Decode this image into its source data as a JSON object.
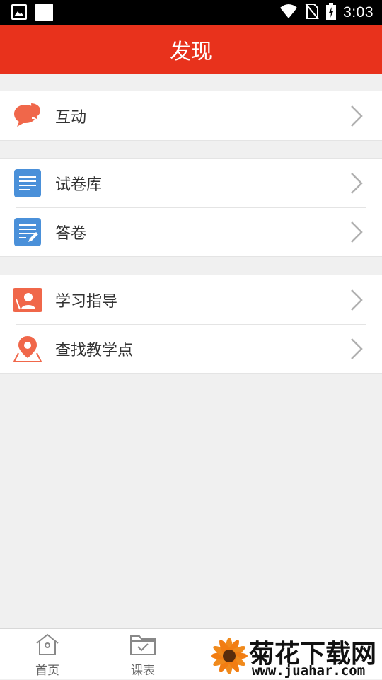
{
  "status_bar": {
    "time": "3:03",
    "icons": [
      "image-icon",
      "square-notification-icon",
      "wifi-icon",
      "no-sim-icon",
      "battery-charging-icon"
    ]
  },
  "header": {
    "title": "发现"
  },
  "groups": [
    {
      "items": [
        {
          "label": "互动",
          "icon": "chat-bubbles-icon",
          "color": "#f0674a"
        }
      ]
    },
    {
      "items": [
        {
          "label": "试卷库",
          "icon": "document-icon",
          "color": "#4a90d9"
        },
        {
          "label": "答卷",
          "icon": "edit-document-icon",
          "color": "#4a90d9"
        }
      ]
    },
    {
      "items": [
        {
          "label": "学习指导",
          "icon": "guide-person-icon",
          "color": "#f0674a"
        },
        {
          "label": "查找教学点",
          "icon": "location-pin-icon",
          "color": "#f0674a"
        }
      ]
    }
  ],
  "bottom_nav": {
    "items": [
      {
        "label": "首页",
        "icon": "home-icon"
      },
      {
        "label": "课表",
        "icon": "schedule-folder-icon"
      }
    ]
  },
  "watermark": {
    "title": "菊花下载网",
    "url": "www.juahar.com",
    "icon": "flower-icon"
  },
  "colors": {
    "header": "#e8321c",
    "accent_orange": "#f0674a",
    "accent_blue": "#4a90d9"
  }
}
